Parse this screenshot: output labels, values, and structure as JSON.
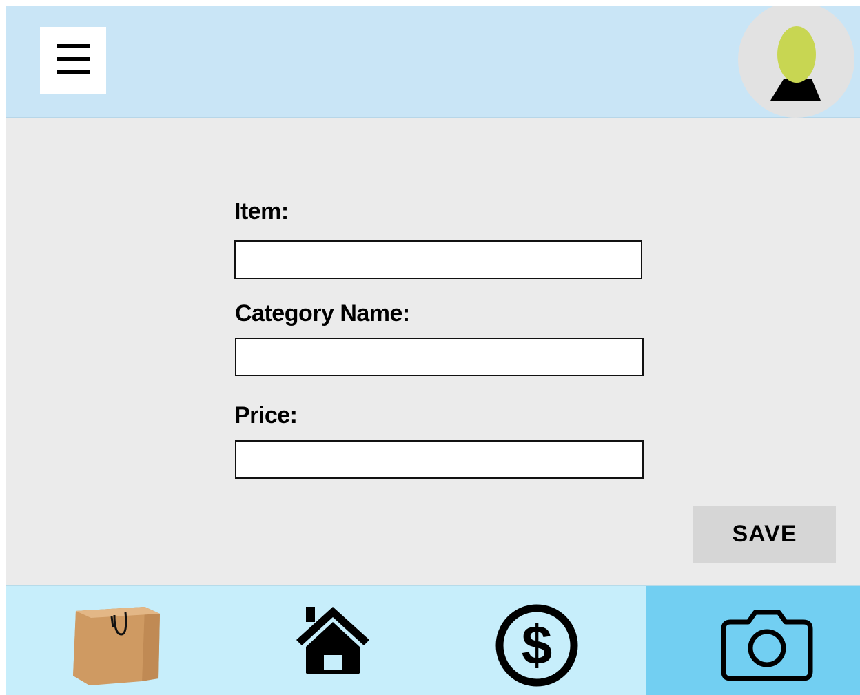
{
  "header": {
    "menu_icon": "hamburger-menu-icon",
    "avatar_icon": "user-avatar-icon",
    "avatar_colors": {
      "head": "#c8d652",
      "body": "#000000",
      "background": "#e2e2e2"
    }
  },
  "form": {
    "item": {
      "label": "Item:",
      "value": "",
      "placeholder": ""
    },
    "category": {
      "label": "Category Name:",
      "value": "",
      "placeholder": ""
    },
    "price": {
      "label": "Price:",
      "value": "",
      "placeholder": ""
    },
    "save_label": "SAVE"
  },
  "bottom_nav": {
    "items": [
      {
        "icon": "shopping-bag-icon",
        "active": false
      },
      {
        "icon": "home-icon",
        "active": false
      },
      {
        "icon": "dollar-icon",
        "active": false
      },
      {
        "icon": "camera-icon",
        "active": true
      }
    ],
    "active_color": "#72cff2",
    "background_color": "#c7eefb"
  },
  "colors": {
    "header_background": "#c9e5f6",
    "content_background": "#ebebeb",
    "save_button_background": "#d6d6d6"
  }
}
